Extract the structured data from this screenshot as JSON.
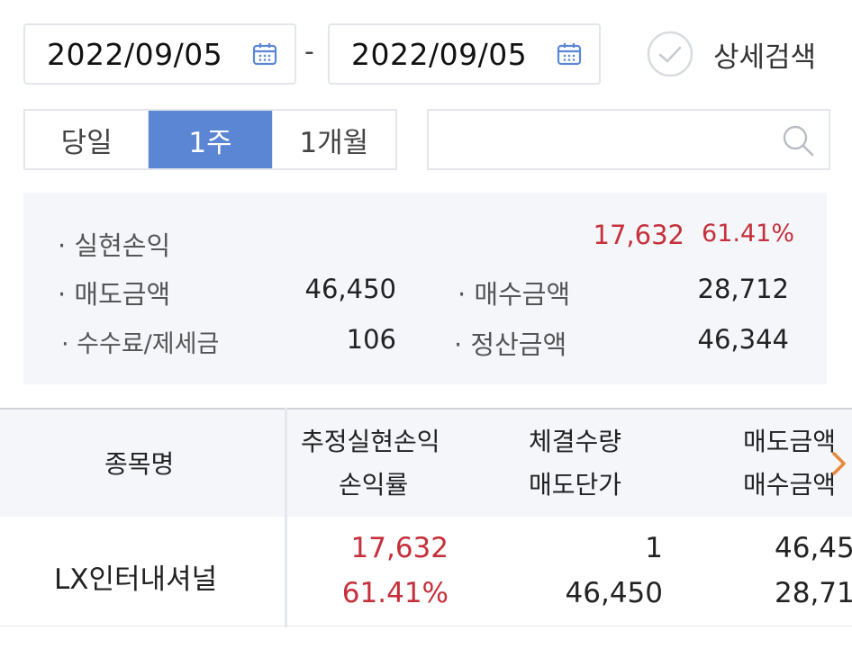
{
  "date_range": {
    "start": "2022/09/05",
    "separator": "-",
    "end": "2022/09/05"
  },
  "detail_search": {
    "label": "상세검색"
  },
  "period_buttons": [
    "당일",
    "1주",
    "1개월"
  ],
  "active_period": "1주",
  "search": {
    "placeholder": ""
  },
  "summary": {
    "realized_pl_label": "· 실현손익",
    "realized_pl_value": "17,632",
    "realized_pl_rate": "61.41%",
    "sell_amount_label": "· 매도금액",
    "sell_amount_value": "46,450",
    "buy_amount_label": "· 매수금액",
    "buy_amount_value": "28,712",
    "fee_tax_label": "· 수수료/제세금",
    "fee_tax_value": "106",
    "settlement_label": "· 정산금액",
    "settlement_value": "46,344"
  },
  "table": {
    "headers": {
      "name": "종목명",
      "est_pl": "추정실현손익",
      "pl_rate": "손익률",
      "exec_qty": "체결수량",
      "sell_price": "매도단가",
      "sell_amount": "매도금액",
      "buy_amount": "매수금액"
    },
    "rows": [
      {
        "name": "LX인터내셔널",
        "est_pl": "17,632",
        "pl_rate": "61.41%",
        "exec_qty": "1",
        "sell_price": "46,450",
        "sell_amount": "46,45",
        "buy_amount": "28,71"
      }
    ]
  },
  "colors": {
    "accent": "#5b86d4",
    "profit": "#c5303a",
    "panel_bg": "#f4f6fa",
    "border": "#e3e6ea"
  }
}
